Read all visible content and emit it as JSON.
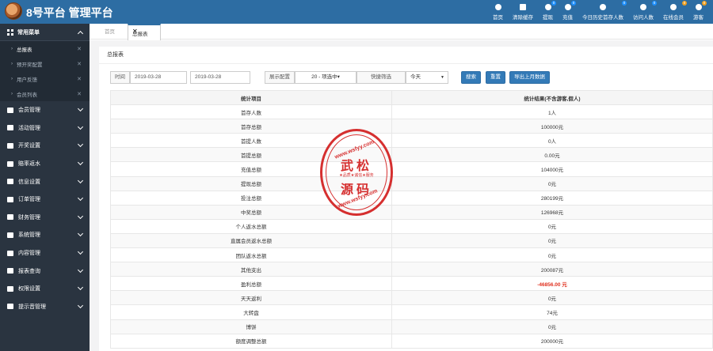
{
  "header": {
    "title": "8号平台 管理平台",
    "nav": [
      {
        "label": "首页",
        "icon": "home-icon"
      },
      {
        "label": "清除缓存",
        "icon": "trash-icon"
      },
      {
        "label": "提现",
        "icon": "withdraw-icon",
        "badge": "0"
      },
      {
        "label": "充值",
        "icon": "deposit-icon",
        "badge": "0"
      },
      {
        "label": "今日历史首存人数",
        "icon": "users-icon",
        "badge": "0"
      },
      {
        "label": "访问人数",
        "icon": "visitors-icon",
        "badge": "0"
      },
      {
        "label": "在线会员",
        "icon": "user-icon",
        "badge": "0"
      },
      {
        "label": "游客",
        "icon": "guest-icon",
        "badge": "0"
      }
    ]
  },
  "sidebar": {
    "head": "常用菜单",
    "sub_items": [
      {
        "label": "总报表",
        "active": true
      },
      {
        "label": "预开奖配置",
        "active": false
      },
      {
        "label": "用户反馈",
        "active": false
      },
      {
        "label": "会员列表",
        "active": false
      }
    ],
    "menu": [
      {
        "label": "会员管理",
        "icon": "user-icon"
      },
      {
        "label": "活动管理",
        "icon": "calendar-icon"
      },
      {
        "label": "开奖设置",
        "icon": "star-icon"
      },
      {
        "label": "赔率返水",
        "icon": "diamond-icon"
      },
      {
        "label": "信息设置",
        "icon": "mail-icon"
      },
      {
        "label": "订单管理",
        "icon": "list-icon"
      },
      {
        "label": "财务管理",
        "icon": "finance-icon"
      },
      {
        "label": "系统管理",
        "icon": "gear-icon"
      },
      {
        "label": "内容管理",
        "icon": "grid-icon"
      },
      {
        "label": "报表查询",
        "icon": "search-icon"
      },
      {
        "label": "权限设置",
        "icon": "key-icon"
      },
      {
        "label": "提示音管理",
        "icon": "bell-icon"
      }
    ]
  },
  "tabs": {
    "home": "首页",
    "active": "总报表"
  },
  "panel": {
    "title": "总报表"
  },
  "filter": {
    "time_label": "时间",
    "date_from": "2019-03-28",
    "date_to": "2019-03-28",
    "display_label": "展示配置",
    "display_value": "20 - 项选中▾",
    "quick_label": "快捷筛选",
    "quick_value": "今天",
    "search_btn": "搜索",
    "reset_btn": "重置",
    "export_btn": "导出上月数据"
  },
  "table": {
    "headers": [
      "统计项目",
      "统计结果(不含游客,假人)"
    ],
    "rows": [
      [
        "首存人数",
        "1人"
      ],
      [
        "首存总额",
        "100000元"
      ],
      [
        "首提人数",
        "0人"
      ],
      [
        "首提总额",
        "0.00元"
      ],
      [
        "充值总额",
        "104000元"
      ],
      [
        "提现总额",
        "0元"
      ],
      [
        "投注总额",
        "280199元"
      ],
      [
        "中奖总额",
        "126968元"
      ],
      [
        "个人返水总额",
        "0元"
      ],
      [
        "直属会员返水总额",
        "0元"
      ],
      [
        "团队返水总额",
        "0元"
      ],
      [
        "其他支出",
        "200087元"
      ],
      [
        "盈利总额",
        "-46856.00 元"
      ],
      [
        "天天返利",
        "0元"
      ],
      [
        "大转盘",
        "74元"
      ],
      [
        "博饼",
        "0元"
      ],
      [
        "额度调整总额",
        "200000元"
      ]
    ]
  },
  "stamp": {
    "url": "www.wsfyy.com",
    "big1": "武松",
    "mid": "★品质★诚信★服务",
    "big2": "源码"
  }
}
